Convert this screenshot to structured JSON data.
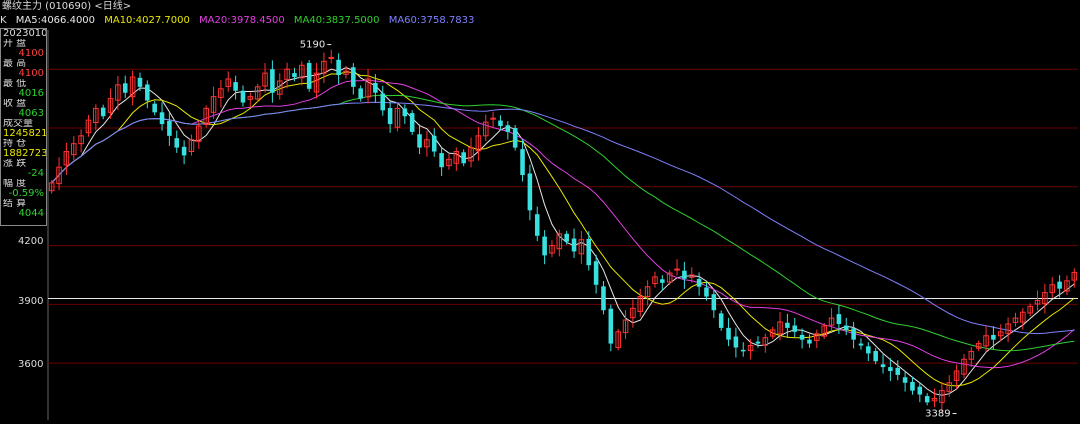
{
  "title": "螺纹主力 (010690) <日线>",
  "ma_prefix": "K",
  "ma_legend": [
    {
      "text": "MA5:4066.4000",
      "color": "#e8e8e8"
    },
    {
      "text": "MA10:4027.7000",
      "color": "#e8e800"
    },
    {
      "text": "MA20:3978.4500",
      "color": "#e040e0"
    },
    {
      "text": "MA40:3837.5000",
      "color": "#30d030"
    },
    {
      "text": "MA60:3758.7833",
      "color": "#8080ff"
    }
  ],
  "info": {
    "date": "20230103",
    "rows": [
      {
        "label": "开 盘",
        "value": "4100",
        "color": "#ff4040"
      },
      {
        "label": "最 高",
        "value": "4100",
        "color": "#ff4040"
      },
      {
        "label": "最 低",
        "value": "4016",
        "color": "#30d030"
      },
      {
        "label": "收 盘",
        "value": "4063",
        "color": "#30d030"
      },
      {
        "label": "成交量",
        "value": "1245821",
        "color": "#e8e800"
      },
      {
        "label": "持 仓",
        "value": "1882723",
        "color": "#e8e800"
      },
      {
        "label": "涨 跌",
        "value": "-24",
        "color": "#30d030"
      },
      {
        "label": "幅 度",
        "value": "-0.59%",
        "color": "#30d030"
      },
      {
        "label": "结 算",
        "value": "4044",
        "color": "#30d030"
      }
    ]
  },
  "chart_data": {
    "type": "candlestick",
    "y_ticks": [
      4200,
      3900,
      3600
    ],
    "ylim": [
      3310,
      5300
    ],
    "current_price_line": 3930,
    "annotations": [
      {
        "text": "5190",
        "value": 5190,
        "index": 38
      },
      {
        "text": "3389",
        "value": 3389,
        "index": 123
      }
    ],
    "closes": [
      4520,
      4600,
      4680,
      4720,
      4760,
      4840,
      4900,
      4860,
      4950,
      5020,
      4980,
      5060,
      5010,
      4940,
      4880,
      4820,
      4760,
      4700,
      4660,
      4740,
      4810,
      4900,
      4960,
      5000,
      5050,
      4990,
      4930,
      4960,
      5010,
      5080,
      4980,
      5040,
      5100,
      5060,
      5120,
      5000,
      5080,
      5140,
      5160,
      5070,
      5090,
      5010,
      4950,
      5050,
      4980,
      4890,
      4820,
      4900,
      4860,
      4780,
      4700,
      4740,
      4680,
      4600,
      4640,
      4680,
      4620,
      4700,
      4760,
      4830,
      4850,
      4810,
      4780,
      4700,
      4560,
      4380,
      4250,
      4150,
      4200,
      4260,
      4220,
      4170,
      4230,
      4100,
      4000,
      3870,
      3700,
      3760,
      3820,
      3880,
      3940,
      3990,
      4040,
      4010,
      4060,
      4080,
      4030,
      4050,
      3990,
      3940,
      3870,
      3780,
      3720,
      3680,
      3660,
      3690,
      3700,
      3730,
      3770,
      3810,
      3780,
      3760,
      3720,
      3700,
      3750,
      3790,
      3830,
      3800,
      3770,
      3720,
      3690,
      3650,
      3610,
      3580,
      3560,
      3540,
      3500,
      3460,
      3440,
      3400,
      3420,
      3460,
      3500,
      3560,
      3620,
      3660,
      3700,
      3740,
      3720,
      3760,
      3800,
      3830,
      3860,
      3890,
      3920,
      3960,
      4000,
      3980,
      4020,
      4063
    ]
  }
}
